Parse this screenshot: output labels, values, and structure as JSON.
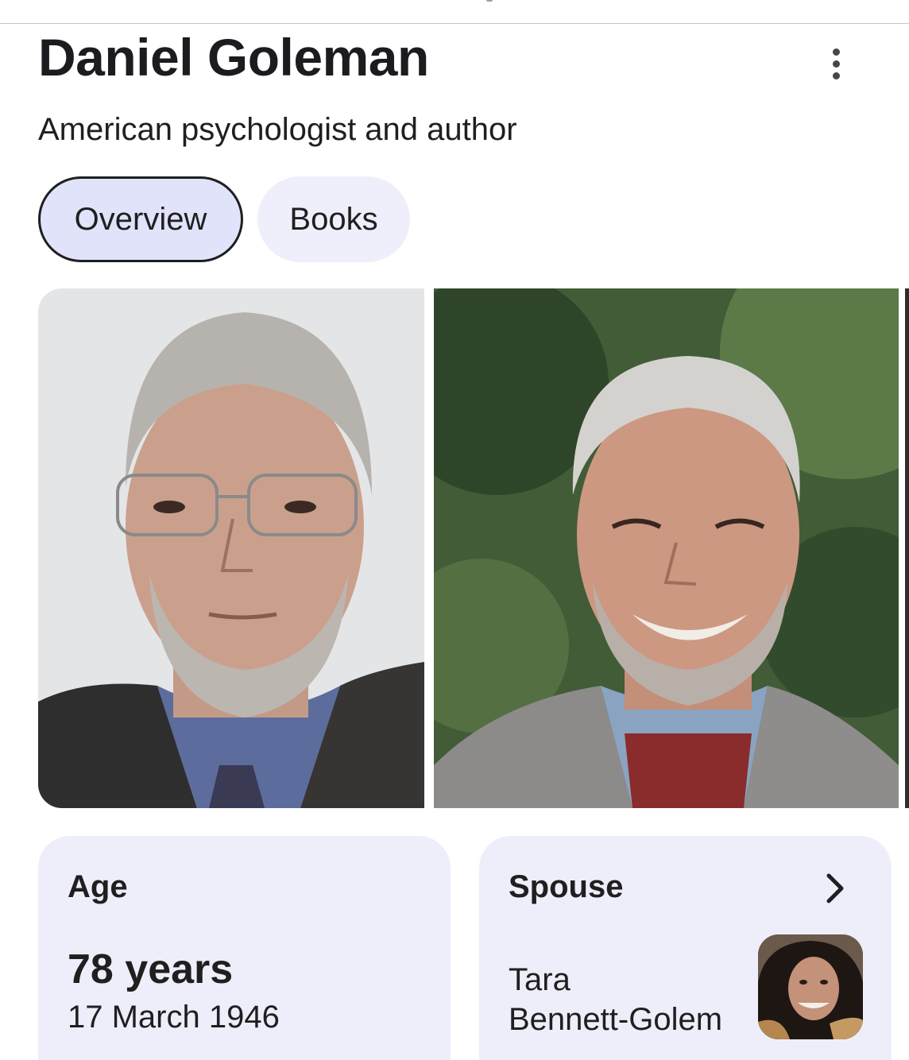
{
  "panel": {
    "title": "Daniel Goleman",
    "subtitle": "American psychologist and author",
    "more_options_icon": "more-vert-icon"
  },
  "tabs": [
    {
      "label": "Overview",
      "selected": true
    },
    {
      "label": "Books",
      "selected": false
    }
  ],
  "images": [
    {
      "alt": "Daniel Goleman photo"
    },
    {
      "alt": "Daniel Goleman smiling photo"
    }
  ],
  "facts": {
    "age": {
      "label": "Age",
      "value": "78 years",
      "detail": "17 March 1946"
    },
    "spouse": {
      "label": "Spouse",
      "name_line1": "Tara",
      "name_line2": "Bennett-Golem",
      "chevron_icon": "chevron-right-icon"
    }
  },
  "colors": {
    "chip_selected": "#e1e3fb",
    "chip_unselected": "#efeffb",
    "card_background": "#eeeefb"
  }
}
